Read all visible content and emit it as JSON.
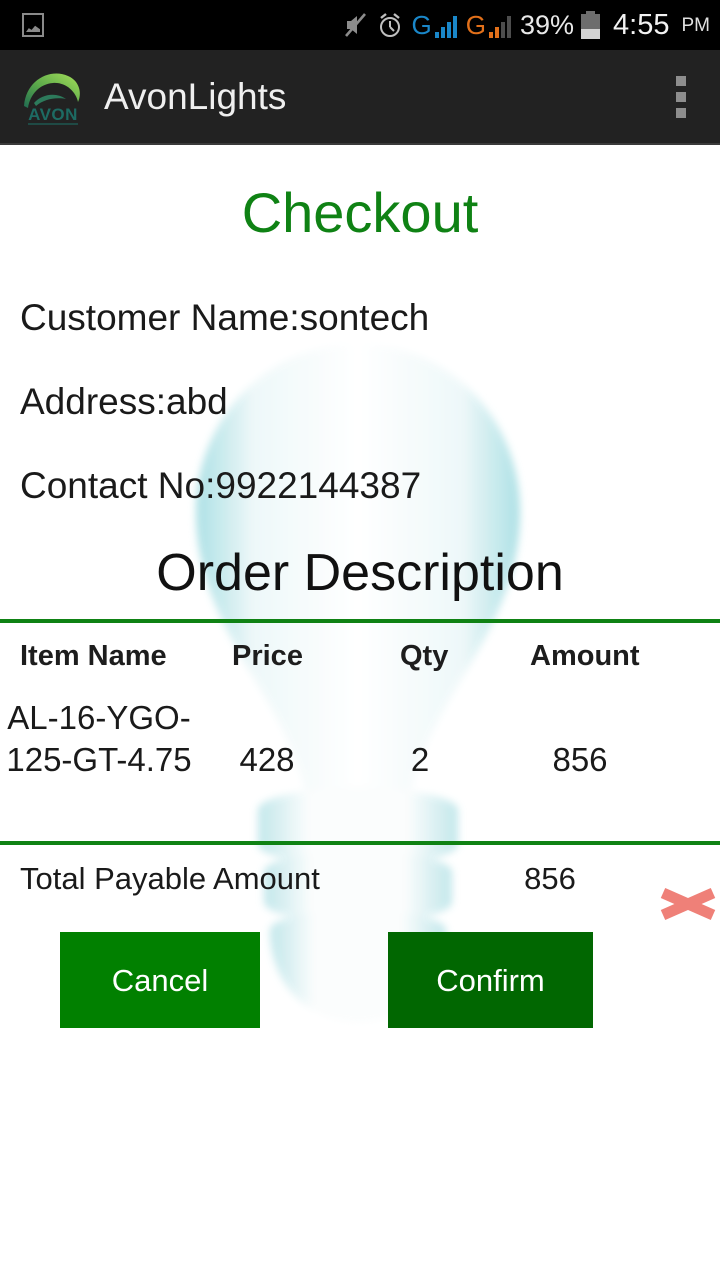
{
  "status_bar": {
    "screenshot_icon": "image-icon",
    "mute_icon": "mute-icon",
    "alarm_icon": "alarm-clock-icon",
    "sim1_network": "G",
    "sim2_network": "G",
    "battery_percent": "39%",
    "time": "4:55",
    "ampm": "PM",
    "colors": {
      "sim1": "#1a87c9",
      "sim2": "#e2701a",
      "background": "#000000"
    }
  },
  "app_bar": {
    "title": "AvonLights",
    "logo_text": "AVON",
    "overflow_menu": "more-options",
    "background": "#222222"
  },
  "page": {
    "title": "Checkout",
    "title_color": "#0f8214",
    "customer_name_line": "Customer Name:sontech",
    "address_line": "Address:abd",
    "contact_line": "Contact No:9922144387",
    "section_title": "Order Description",
    "divider_color": "#0f8214"
  },
  "order_table": {
    "headers": [
      "Item Name",
      "Price",
      "Qty",
      "Amount"
    ],
    "rows": [
      {
        "item_name": "AL-16-YGO-125-GT-4.75",
        "price": "428",
        "qty": "2",
        "amount": "856",
        "delete_icon": "delete-x-icon"
      }
    ]
  },
  "totals": {
    "label": "Total Payable Amount",
    "value": "856"
  },
  "actions": {
    "cancel_label": "Cancel",
    "confirm_label": "Confirm",
    "cancel_color": "#018000",
    "confirm_color": "#016701"
  }
}
